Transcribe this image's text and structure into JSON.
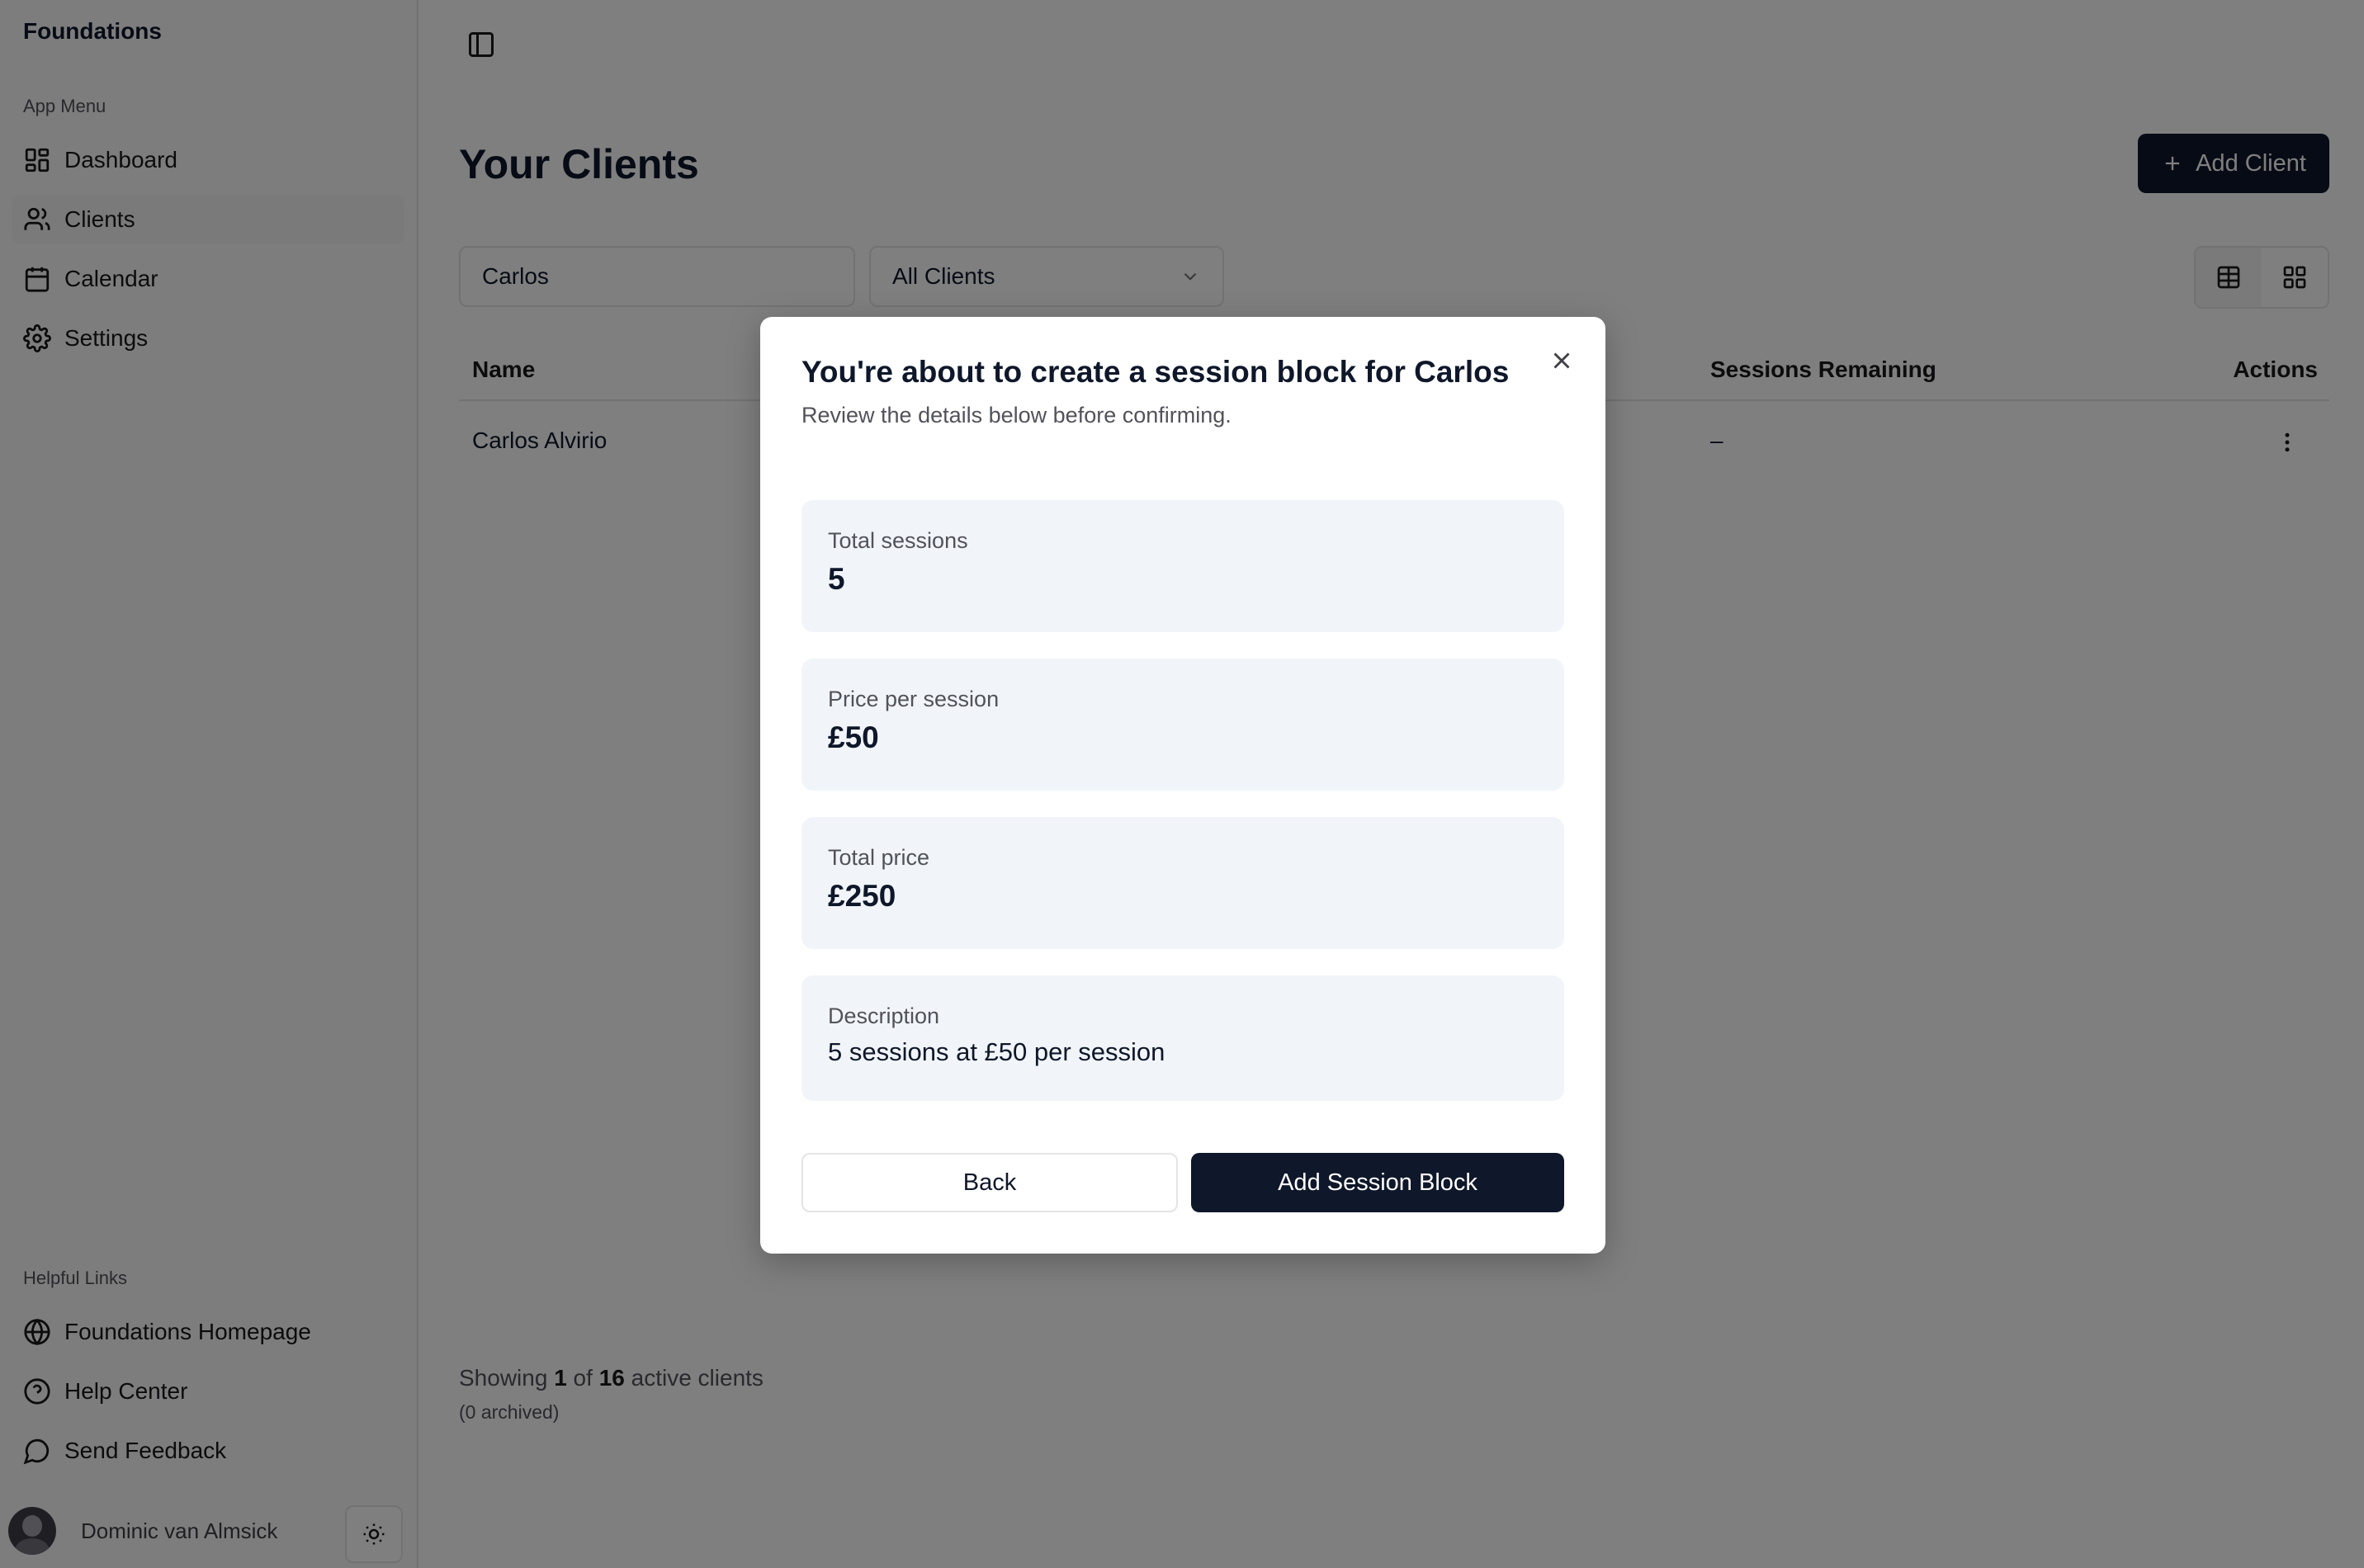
{
  "sidebar": {
    "brand": "Foundations",
    "app_menu_label": "App Menu",
    "items": [
      {
        "label": "Dashboard",
        "icon": "dashboard-icon"
      },
      {
        "label": "Clients",
        "icon": "users-icon"
      },
      {
        "label": "Calendar",
        "icon": "calendar-icon"
      },
      {
        "label": "Settings",
        "icon": "gear-icon"
      }
    ],
    "helpful_links_label": "Helpful Links",
    "links": [
      {
        "label": "Foundations Homepage",
        "icon": "globe-icon"
      },
      {
        "label": "Help Center",
        "icon": "help-circle-icon"
      },
      {
        "label": "Send Feedback",
        "icon": "message-icon"
      }
    ],
    "user_name": "Dominic van Almsick"
  },
  "main": {
    "title": "Your Clients",
    "add_client_label": "Add Client",
    "search": {
      "value": "Carlos"
    },
    "filter": {
      "selected": "All Clients"
    },
    "table": {
      "columns": [
        "Name",
        "Sessions Remaining",
        "Actions"
      ],
      "rows": [
        {
          "name": "Carlos Alvirio",
          "sessions_remaining": "–"
        }
      ]
    },
    "footer": {
      "prefix": "Showing",
      "shown": "1",
      "of": "of",
      "total": "16",
      "suffix": "active clients",
      "archived": "(0 archived)"
    }
  },
  "modal": {
    "title": "You're about to create a session block for Carlos",
    "subtitle": "Review the details below before confirming.",
    "fields": [
      {
        "label": "Total sessions",
        "value": "5"
      },
      {
        "label": "Price per session",
        "value": "£50"
      },
      {
        "label": "Total price",
        "value": "£250"
      },
      {
        "label": "Description",
        "value": "5 sessions at £50 per session"
      }
    ],
    "back_label": "Back",
    "confirm_label": "Add Session Block"
  },
  "colors": {
    "primary": "#0f172a",
    "panel": "#f1f5f9",
    "overlay": "rgba(0,0,0,0.5)"
  }
}
